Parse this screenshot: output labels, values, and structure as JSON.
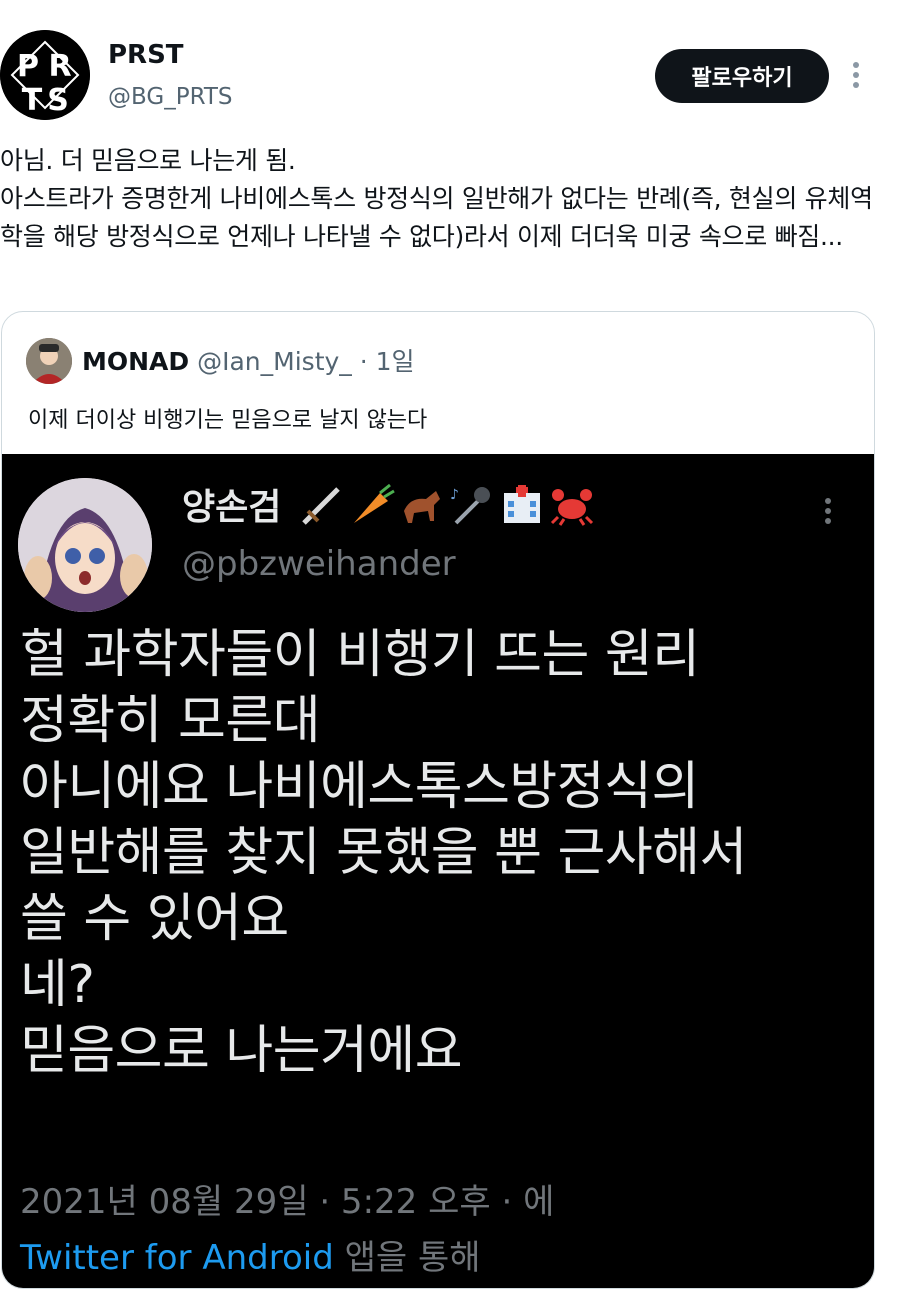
{
  "author": {
    "display_name": "PRST",
    "handle": "@BG_PRTS",
    "avatar_letters": "PRTS"
  },
  "follow_button_label": "팔로우하기",
  "tweet_text": "아님. 더 믿음으로 나는게 됨.\n아스트라가 증명한게 나비에스톡스 방정식의 일반해가 없다는 반례(즉, 현실의 유체역학을 해당 방정식으로 언제나 나타낼 수 없다)라서 이제 더더욱 미궁 속으로 빠짐...",
  "quoted_tweet": {
    "display_name": "MONAD",
    "handle": "@Ian_Misty_",
    "time": "· 1일",
    "text": "이제 더이상 비행기는 믿음으로 날지 않는다",
    "image": {
      "display_name": "양손검",
      "emojis": [
        "dagger-icon",
        "carrot-icon",
        "horse-icon",
        "microphone-icon",
        "hospital-icon",
        "crab-icon"
      ],
      "handle": "@pbzweihander",
      "text": "헐 과학자들이 비행기 뜨는 원리\n정확히 모른대\n아니에요 나비에스톡스방정식의\n일반해를 찾지 못했을 뿐 근사해서\n쓸 수 있어요\n네?\n믿음으로 나는거에요",
      "date_line": "2021년 08월 29일 · 5:22 오후 · 에",
      "source_link": "Twitter for Android",
      "source_suffix": " 앱을 통해"
    }
  },
  "colors": {
    "text_primary": "#0f1419",
    "text_secondary": "#536471",
    "link": "#1d9bf0",
    "dark_bg": "#000000"
  }
}
